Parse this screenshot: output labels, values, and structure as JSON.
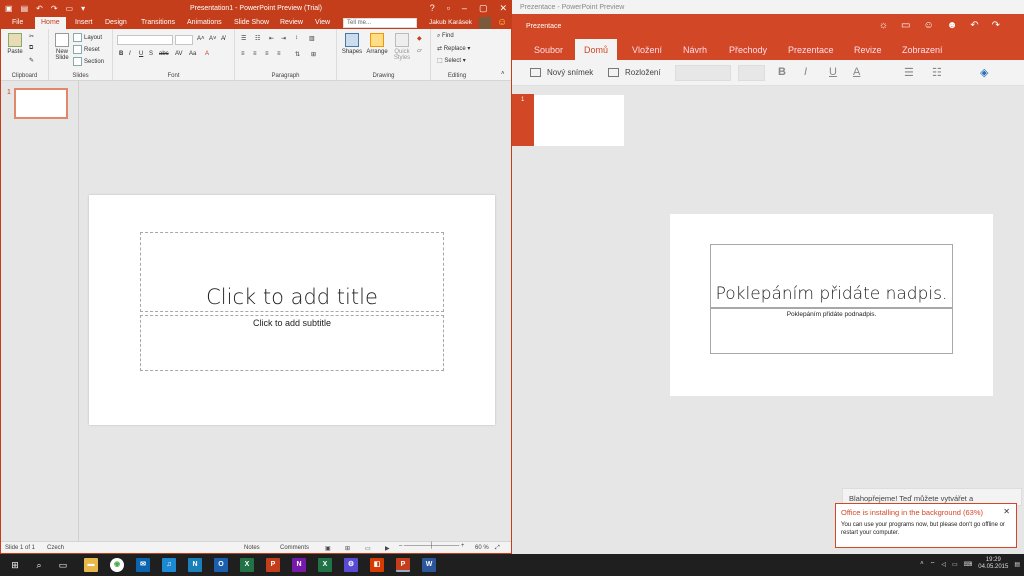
{
  "left_window": {
    "title": "Presentation1 - PowerPoint Preview (Trial)",
    "tabs": [
      "File",
      "Home",
      "Insert",
      "Design",
      "Transitions",
      "Animations",
      "Slide Show",
      "Review",
      "View"
    ],
    "active_tab": "Home",
    "tellme_placeholder": "Tell me...",
    "user_name": "Jakub Karásek",
    "ribbon": {
      "clipboard": {
        "label": "Clipboard",
        "paste": "Paste"
      },
      "slides": {
        "label": "Slides",
        "new_slide": "New Slide",
        "layout": "Layout",
        "reset": "Reset",
        "section": "Section"
      },
      "font": {
        "label": "Font"
      },
      "paragraph": {
        "label": "Paragraph"
      },
      "drawing": {
        "label": "Drawing",
        "shapes": "Shapes",
        "arrange": "Arrange",
        "quick_styles": "Quick Styles"
      },
      "editing": {
        "label": "Editing",
        "find": "Find",
        "replace": "Replace",
        "select": "Select"
      }
    },
    "thumb_number": "1",
    "slide": {
      "title_placeholder": "Click to add title",
      "subtitle_placeholder": "Click to add subtitle"
    },
    "status": {
      "slide_info": "Slide 1 of 1",
      "language": "Czech",
      "notes": "Notes",
      "comments": "Comments",
      "zoom": "60 %"
    }
  },
  "right_window": {
    "title": "Prezentace - PowerPoint Preview",
    "app_title": "Prezentace",
    "tabs": [
      "Soubor",
      "Domů",
      "Vložení",
      "Návrh",
      "Přechody",
      "Prezentace",
      "Revize",
      "Zobrazení"
    ],
    "active_tab": "Domů",
    "toolbar": {
      "new_slide": "Nový snímek",
      "layout": "Rozložení"
    },
    "thumb_number": "1",
    "slide": {
      "title_placeholder": "Poklepáním přidáte nadpis.",
      "subtitle_placeholder": "Poklepáním přidáte podnadpis."
    }
  },
  "notifications": {
    "background_text": "Blahopřejeme! Teď můžete vytvářet a",
    "toast_title": "Office is installing in the background (63%)",
    "toast_message": "You can use your programs now, but please don't go offline or restart your computer.",
    "install_progress": 63
  },
  "taskbar": {
    "time": "19:29",
    "date": "04.05.2015"
  },
  "colors": {
    "ppt_accent": "#c43e1c",
    "mobile_accent": "#d24726"
  }
}
